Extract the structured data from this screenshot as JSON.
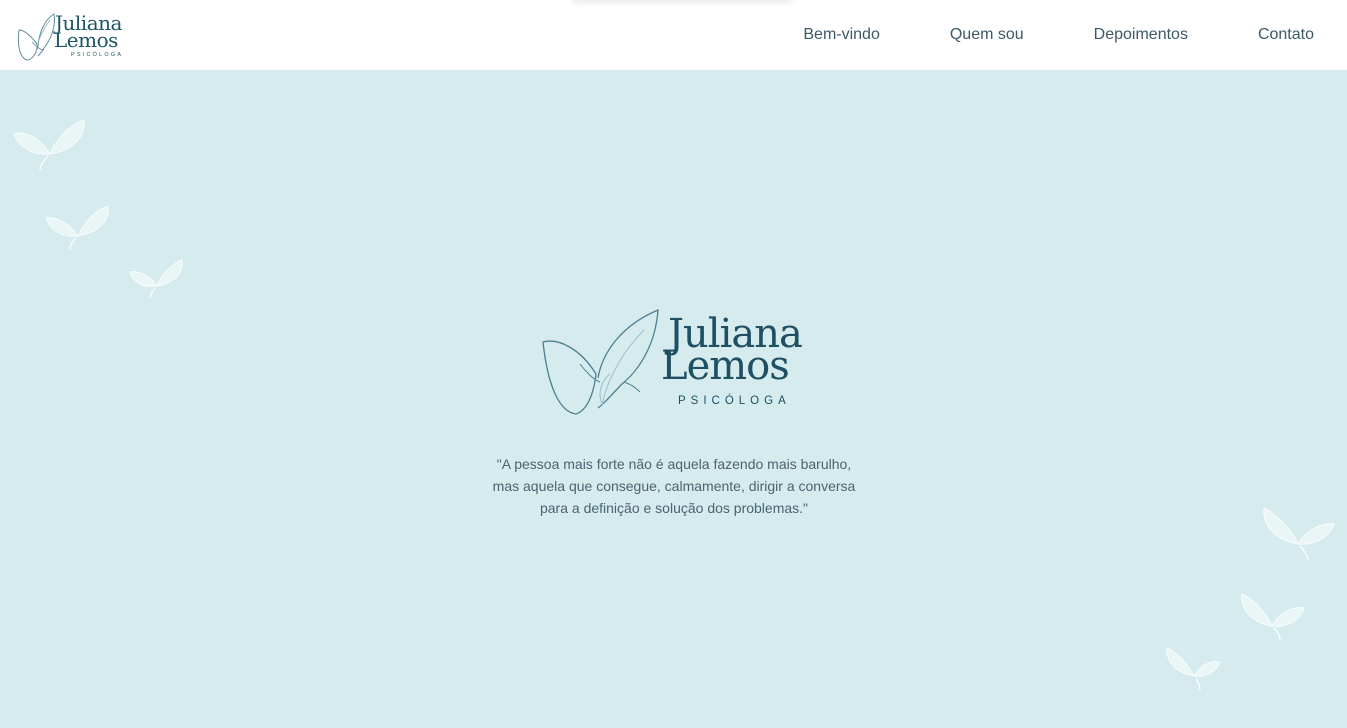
{
  "header": {
    "brand": {
      "name_line1": "Juliana",
      "name_line2": "Lemos",
      "subtitle": "PSICÓLOGA",
      "icon": "butterfly-icon"
    },
    "nav": [
      {
        "label": "Bem-vindo"
      },
      {
        "label": "Quem sou"
      },
      {
        "label": "Depoimentos"
      },
      {
        "label": "Contato"
      }
    ]
  },
  "hero": {
    "logo": {
      "name_line1": "Juliana",
      "name_line2": "Lemos",
      "subtitle": "PSICÓLOGA",
      "icon": "butterfly-icon"
    },
    "quote_lines": [
      "\"A pessoa mais forte não é aquela fazendo mais barulho,",
      "mas aquela que consegue, calmamente, dirigir a conversa",
      "para a definição e solução dos problemas.\""
    ],
    "decorations": [
      "butterfly-icon"
    ]
  },
  "colors": {
    "background": "#d5ebee",
    "header": "#ffffff",
    "brand": "#1e4f63",
    "nav_text": "#3f5866",
    "quote_text": "#4a6470",
    "decor_butterfly": "#ffffff"
  }
}
